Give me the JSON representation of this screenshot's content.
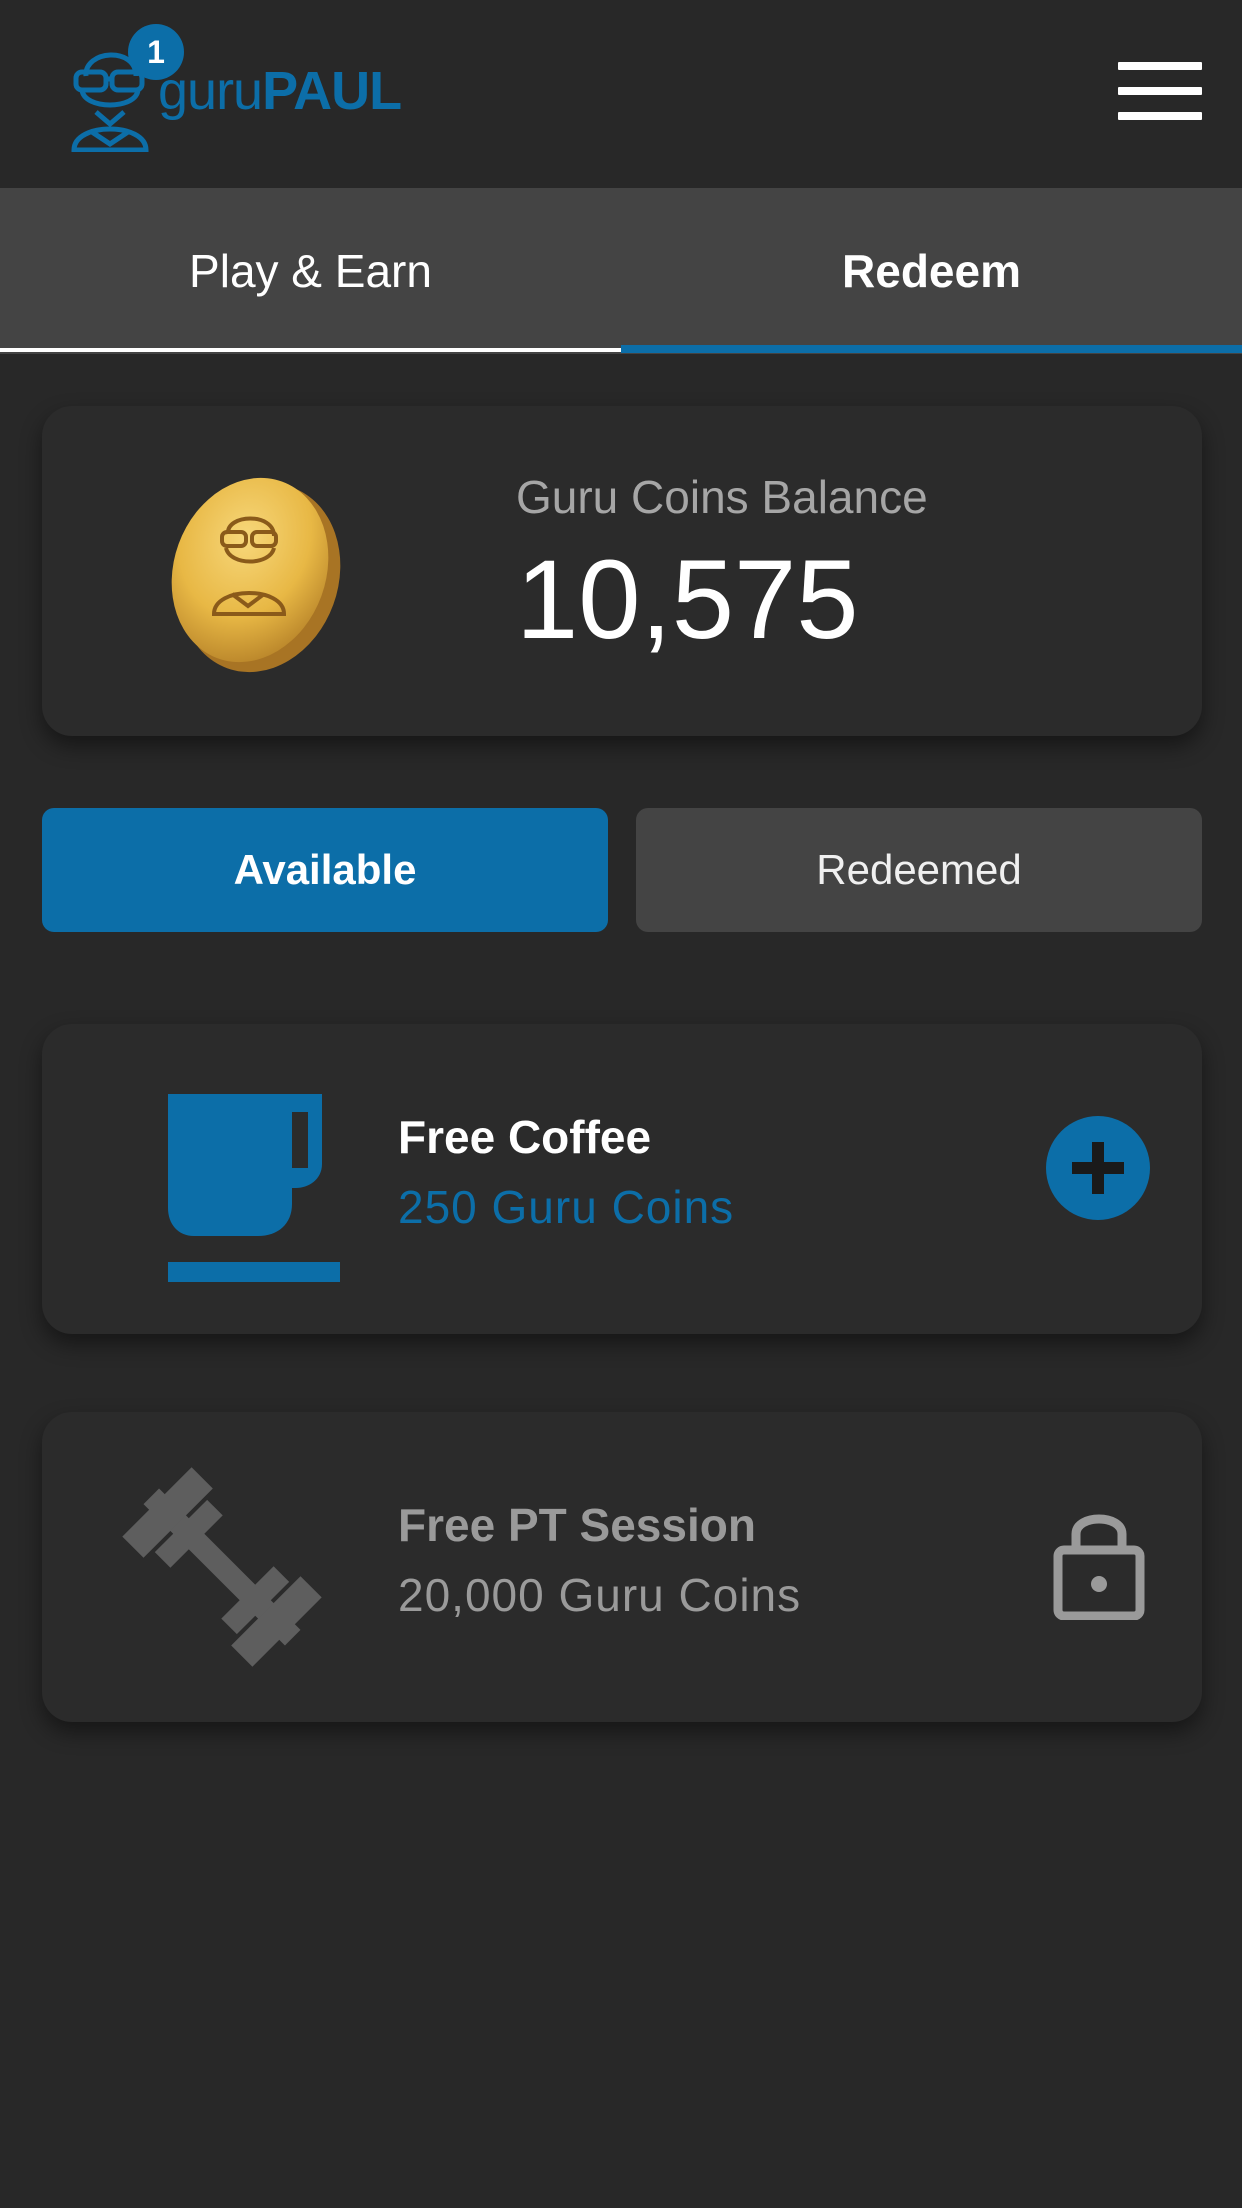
{
  "header": {
    "logo_text_light": "guru",
    "logo_text_bold": "PAUL",
    "notification_count": "1",
    "menu_icon": "hamburger-menu-icon"
  },
  "tabs": [
    {
      "label": "Play & Earn",
      "active": false
    },
    {
      "label": "Redeem",
      "active": true
    }
  ],
  "balance": {
    "label": "Guru Coins Balance",
    "value": "10,575",
    "icon": "gold-coin-icon"
  },
  "filters": {
    "available_label": "Available",
    "redeemed_label": "Redeemed",
    "selected": "Available"
  },
  "rewards": [
    {
      "title": "Free Coffee",
      "cost": "250 Guru Coins",
      "icon": "coffee-cup-icon",
      "action_icon": "plus-icon",
      "locked": false
    },
    {
      "title": "Free PT Session",
      "cost": "20,000 Guru Coins",
      "icon": "dumbbell-icon",
      "action_icon": "lock-icon",
      "locked": true
    }
  ],
  "colors": {
    "accent": "#0c6ea8",
    "background": "#282828",
    "card": "#2b2b2b",
    "tab_bar": "#444444",
    "coin_gold": "#e8b845",
    "muted_text": "#9a9a9a"
  }
}
